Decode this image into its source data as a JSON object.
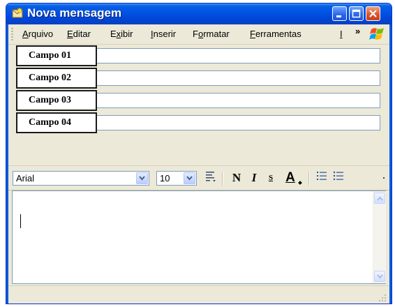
{
  "window": {
    "title": "Nova mensagem",
    "colors": {
      "titlebar": "#0055e5",
      "frame": "#ece9d8",
      "close": "#d8532a"
    }
  },
  "menu": {
    "items": [
      {
        "id": "arquivo",
        "accel": "A",
        "rest": "rquivo"
      },
      {
        "id": "editar",
        "accel": "E",
        "rest": "ditar"
      },
      {
        "id": "exibir",
        "pre": "E",
        "accel": "x",
        "rest": "ibir"
      },
      {
        "id": "inserir",
        "accel": "I",
        "rest": "nserir"
      },
      {
        "id": "formatar",
        "pre": "F",
        "accel": "o",
        "rest": "rmatar"
      },
      {
        "id": "ferramentas",
        "accel": "F",
        "rest": "erramentas"
      }
    ],
    "overflow_label": "»",
    "truncated_item": "I"
  },
  "fields": [
    {
      "label": "Campo 01",
      "value": ""
    },
    {
      "label": "Campo 02",
      "value": ""
    },
    {
      "label": "Campo 03",
      "value": ""
    },
    {
      "label": "Campo 04",
      "value": ""
    }
  ],
  "format_toolbar": {
    "font": "Arial",
    "size": "10",
    "bold_label": "N",
    "italic_label": "I",
    "underline_label": "S",
    "font_color_label": "A"
  },
  "body": {
    "text": ""
  },
  "icons": [
    "new-message-icon",
    "minimize-icon",
    "maximize-icon",
    "close-icon",
    "windows-logo-icon",
    "paragraph-style-icon",
    "numbered-list-icon",
    "bulleted-list-icon",
    "scroll-up-icon",
    "scroll-down-icon",
    "resize-grip-icon"
  ]
}
